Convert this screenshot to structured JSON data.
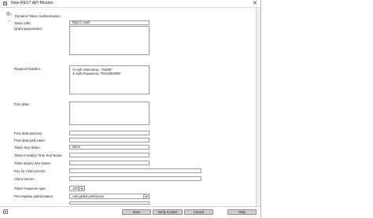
{
  "window": {
    "title": "New REST API Monitor",
    "close_glyph": "✕",
    "app_icon": "monitor-app-icon"
  },
  "form": {
    "auth_option": "Dynamic Token Authentication",
    "required_marker": "*",
    "token_url_label": "Token URL:",
    "token_url_value": "https://               /auth",
    "query_params_label": "Query parameters:",
    "request_headers_label": "Request headers:",
    "request_headers_lines": [
      "X-Auth-Username= \"NAME\"",
      "X-Auth-Password= \"PASSWORD\""
    ],
    "post_data_label": "Post data:",
    "post_data_pwd_key_label": "Post data pwd key:",
    "post_data_pwd_value_label": "Post data pwd value:",
    "token_key_name_label": "Token Key Name:",
    "token_key_name_value": "token",
    "token_creation_time_key_label": "Token Creation Time Key Name:",
    "token_expiry_key_label": "Token Expiry Key Name:",
    "key_client_secret_label": "Key for Client secret:",
    "client_secret_label": "Client Secret:",
    "token_response_type_label": "Token response type:",
    "token_response_type_value": "JSON",
    "preemptive_auth_label": "Pre-emptive authorization:",
    "preemptive_auth_value": "Use global preference"
  },
  "footer": {
    "save": "Save",
    "verify_save": "Verify & Save",
    "cancel": "Cancel",
    "help": "Help"
  }
}
